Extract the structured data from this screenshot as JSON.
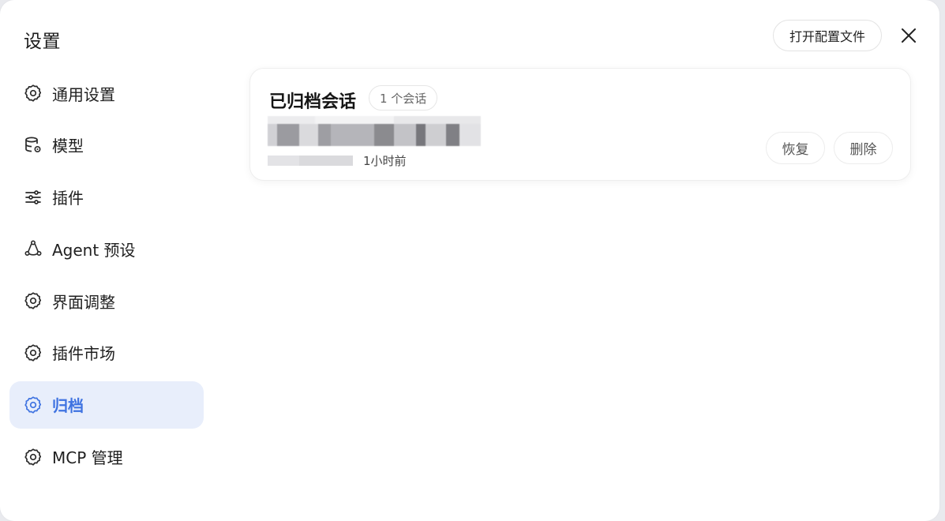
{
  "window": {
    "title": "设置",
    "open_config_label": "打开配置文件",
    "close_icon": "close-icon"
  },
  "sidebar": {
    "items": [
      {
        "label": "通用设置",
        "icon": "gear-icon",
        "active": false
      },
      {
        "label": "模型",
        "icon": "database-gear-icon",
        "active": false
      },
      {
        "label": "插件",
        "icon": "sliders-icon",
        "active": false
      },
      {
        "label": "Agent 预设",
        "icon": "agent-nodes-icon",
        "active": false
      },
      {
        "label": "界面调整",
        "icon": "gear-icon",
        "active": false
      },
      {
        "label": "插件市场",
        "icon": "gear-icon",
        "active": false
      },
      {
        "label": "归档",
        "icon": "gear-icon",
        "active": true
      },
      {
        "label": "MCP 管理",
        "icon": "gear-icon",
        "active": false
      }
    ]
  },
  "archive": {
    "title": "已归档会话",
    "count_label": "1 个会话",
    "sessions": [
      {
        "time": "1小时前",
        "restore_label": "恢复",
        "delete_label": "删除"
      }
    ]
  },
  "colors": {
    "accent": "#3f73e1",
    "active_bg": "#e8eefb"
  }
}
